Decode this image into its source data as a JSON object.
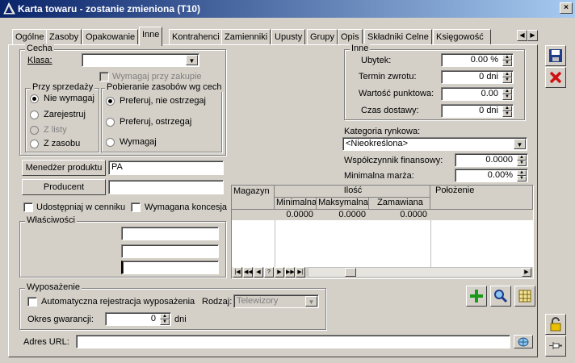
{
  "window": {
    "title": "Karta towaru - zostanie zmieniona (T10)",
    "close": "×"
  },
  "tabs": [
    "Ogólne",
    "Zasoby",
    "Opakowanie",
    "Inne",
    "Kontrahenci",
    "Zamienniki",
    "Upusty",
    "Grupy",
    "Opis",
    "Składniki Celne",
    "Księgowość"
  ],
  "active_tab": "Inne",
  "cecha": {
    "legend": "Cecha",
    "klasa_label": "Klasa:",
    "klasa_value": "",
    "wymagaj_label": "Wymagaj przy zakupie",
    "przy_sprzedazy": {
      "legend": "Przy sprzedaży",
      "options": [
        "Nie wymagaj",
        "Zarejestruj",
        "Z listy",
        "Z zasobu"
      ]
    },
    "pobieranie": {
      "legend": "Pobieranie zasobów wg cech",
      "options": [
        "Preferuj, nie ostrzegaj",
        "Preferuj, ostrzegaj",
        "Wymagaj"
      ]
    }
  },
  "menedzer": {
    "button": "Menedżer produktu",
    "value": "PA"
  },
  "producent": {
    "button": "Producent",
    "value": ""
  },
  "udostepniaj_label": "Udostępniaj w cenniku",
  "koncesja_label": "Wymagana koncesja",
  "wlasciwosci": {
    "legend": "Właściwości",
    "fields": [
      "",
      "",
      ""
    ]
  },
  "inne": {
    "legend": "Inne",
    "ubytek_label": "Ubytek:",
    "ubytek_value": "0.00 %",
    "termin_label": "Termin zwrotu:",
    "termin_value": "0 dni",
    "punktowa_label": "Wartość punktowa:",
    "punktowa_value": "0.00",
    "czas_label": "Czas dostawy:",
    "czas_value": "0 dni"
  },
  "kategoria": {
    "label": "Kategoria rynkowa:",
    "value": "<Nieokreślona>"
  },
  "wspolczynnik": {
    "label": "Współczynnik finansowy:",
    "value": "0.0000"
  },
  "marza": {
    "label": "Minimalna marża:",
    "value": "0.00%"
  },
  "grid": {
    "headers": {
      "magazyn": "Magazyn",
      "ilosc": "Ilość",
      "minimalna": "Minimalna",
      "maksymalna": "Maksymalna",
      "zamawiana": "Zamawiana",
      "polozenie": "Położenie"
    },
    "row": {
      "magazyn": "",
      "minimalna": "0.0000",
      "maksymalna": "0.0000",
      "zamawiana": "0.0000",
      "polozenie": ""
    },
    "nav": [
      "|◀",
      "◀◀",
      "◀",
      "?",
      "▶",
      "▶▶",
      "▶|"
    ]
  },
  "wyposazenie": {
    "legend": "Wyposażenie",
    "auto_label": "Automatyczna rejestracja wyposażenia",
    "rodzaj_label": "Rodzaj:",
    "rodzaj_value": "Telewizory",
    "okres_label": "Okres gwarancji:",
    "okres_value": "0",
    "okres_unit": "dni"
  },
  "url": {
    "label": "Adres URL:",
    "value": ""
  },
  "colors": {
    "titlebar_start": "#0a246a",
    "titlebar_end": "#a6caf0",
    "face": "#d4d0c8",
    "row_highlight": "#d4d0c8"
  }
}
